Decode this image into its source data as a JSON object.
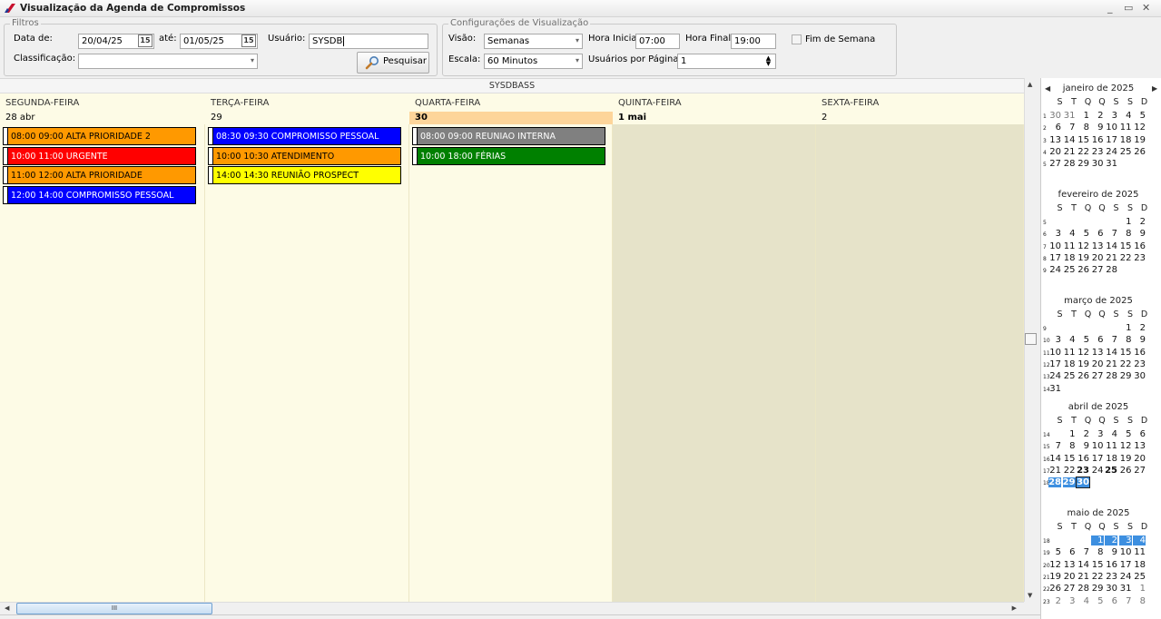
{
  "window": {
    "title": "Visualização da Agenda de Compromissos"
  },
  "filters": {
    "legend": "Filtros",
    "date_from_label": "Data de:",
    "date_from": "20/04/25",
    "date_to_label": "até:",
    "date_to": "01/05/25",
    "user_label": "Usuário:",
    "user": "SYSDB",
    "classification_label": "Classificação:",
    "classification": "",
    "search_button": "Pesquisar",
    "cal_icon_text": "15"
  },
  "view_settings": {
    "legend": "Configurações de Visualização",
    "view_label": "Visão:",
    "view": "Semanas",
    "start_hour_label": "Hora Inicial",
    "start_hour": "07:00",
    "end_hour_label": "Hora Final",
    "end_hour": "19:00",
    "weekend_label": "Fim de Semana",
    "scale_label": "Escala:",
    "scale": "60 Minutos",
    "users_per_page_label": "Usuários por Página",
    "users_per_page": "1"
  },
  "agenda": {
    "user_header": "SYSDBASS",
    "days": [
      {
        "name": "SEGUNDA-FEIRA",
        "number": "28 abr"
      },
      {
        "name": "TERÇA-FEIRA",
        "number": "29"
      },
      {
        "name": "QUARTA-FEIRA",
        "number": "30"
      },
      {
        "name": "QUINTA-FEIRA",
        "number": "1 mai"
      },
      {
        "name": "SEXTA-FEIRA",
        "number": "2"
      }
    ],
    "events": [
      {
        "day": 0,
        "row": 0,
        "text": "08:00 09:00 ALTA PRIORIDADE 2",
        "bg": "#ff9900",
        "fg": "#000000"
      },
      {
        "day": 0,
        "row": 1,
        "text": "10:00 11:00 URGENTE",
        "bg": "#ff0000",
        "fg": "#ffffff"
      },
      {
        "day": 0,
        "row": 2,
        "text": "11:00 12:00 ALTA PRIORIDADE",
        "bg": "#ff9900",
        "fg": "#000000"
      },
      {
        "day": 0,
        "row": 3,
        "text": "12:00 14:00 COMPROMISSO PESSOAL",
        "bg": "#0000ff",
        "fg": "#ffffff"
      },
      {
        "day": 1,
        "row": 0,
        "text": "08:30 09:30 COMPROMISSO PESSOAL",
        "bg": "#0000ff",
        "fg": "#ffffff"
      },
      {
        "day": 1,
        "row": 1,
        "text": "10:00 10:30 ATENDIMENTO",
        "bg": "#ff9900",
        "fg": "#000000"
      },
      {
        "day": 1,
        "row": 2,
        "text": "14:00 14:30 REUNIÃO PROSPECT",
        "bg": "#ffff00",
        "fg": "#000000"
      },
      {
        "day": 2,
        "row": 0,
        "text": "08:00 09:00 REUNIAO INTERNA",
        "bg": "#808080",
        "fg": "#ffffff"
      },
      {
        "day": 2,
        "row": 1,
        "text": "10:00 18:00 FÉRIAS",
        "bg": "#008000",
        "fg": "#ffffff"
      }
    ]
  },
  "scroll": {
    "grip": "III"
  },
  "minicalendar": {
    "weekday_headers": [
      "S",
      "T",
      "Q",
      "Q",
      "S",
      "S",
      "D"
    ],
    "months": [
      {
        "name": "janeiro de 2025",
        "weeks": [
          {
            "wk": "1",
            "days": [
              [
                "30",
                "o"
              ],
              [
                "31",
                "o"
              ],
              [
                "1",
                ""
              ],
              [
                "2",
                ""
              ],
              [
                "3",
                ""
              ],
              [
                "4",
                ""
              ],
              [
                "5",
                ""
              ]
            ]
          },
          {
            "wk": "2",
            "days": [
              [
                "6",
                ""
              ],
              [
                "7",
                ""
              ],
              [
                "8",
                ""
              ],
              [
                "9",
                ""
              ],
              [
                "10",
                ""
              ],
              [
                "11",
                ""
              ],
              [
                "12",
                ""
              ]
            ]
          },
          {
            "wk": "3",
            "days": [
              [
                "13",
                ""
              ],
              [
                "14",
                ""
              ],
              [
                "15",
                ""
              ],
              [
                "16",
                ""
              ],
              [
                "17",
                ""
              ],
              [
                "18",
                ""
              ],
              [
                "19",
                ""
              ]
            ]
          },
          {
            "wk": "4",
            "days": [
              [
                "20",
                ""
              ],
              [
                "21",
                ""
              ],
              [
                "22",
                ""
              ],
              [
                "23",
                ""
              ],
              [
                "24",
                ""
              ],
              [
                "25",
                ""
              ],
              [
                "26",
                ""
              ]
            ]
          },
          {
            "wk": "5",
            "days": [
              [
                "27",
                ""
              ],
              [
                "28",
                ""
              ],
              [
                "29",
                ""
              ],
              [
                "30",
                ""
              ],
              [
                "31",
                ""
              ],
              [
                "",
                ""
              ],
              [
                "",
                ""
              ]
            ]
          }
        ]
      },
      {
        "name": "fevereiro de 2025",
        "weeks": [
          {
            "wk": "5",
            "days": [
              [
                "",
                ""
              ],
              [
                "",
                ""
              ],
              [
                "",
                ""
              ],
              [
                "",
                ""
              ],
              [
                "",
                ""
              ],
              [
                "1",
                ""
              ],
              [
                "2",
                ""
              ]
            ]
          },
          {
            "wk": "6",
            "days": [
              [
                "3",
                ""
              ],
              [
                "4",
                ""
              ],
              [
                "5",
                ""
              ],
              [
                "6",
                ""
              ],
              [
                "7",
                ""
              ],
              [
                "8",
                ""
              ],
              [
                "9",
                ""
              ]
            ]
          },
          {
            "wk": "7",
            "days": [
              [
                "10",
                ""
              ],
              [
                "11",
                ""
              ],
              [
                "12",
                ""
              ],
              [
                "13",
                ""
              ],
              [
                "14",
                ""
              ],
              [
                "15",
                ""
              ],
              [
                "16",
                ""
              ]
            ]
          },
          {
            "wk": "8",
            "days": [
              [
                "17",
                ""
              ],
              [
                "18",
                ""
              ],
              [
                "19",
                ""
              ],
              [
                "20",
                ""
              ],
              [
                "21",
                ""
              ],
              [
                "22",
                ""
              ],
              [
                "23",
                ""
              ]
            ]
          },
          {
            "wk": "9",
            "days": [
              [
                "24",
                ""
              ],
              [
                "25",
                ""
              ],
              [
                "26",
                ""
              ],
              [
                "27",
                ""
              ],
              [
                "28",
                ""
              ],
              [
                "",
                ""
              ],
              [
                "",
                ""
              ]
            ]
          }
        ]
      },
      {
        "name": "março de 2025",
        "weeks": [
          {
            "wk": "9",
            "days": [
              [
                "",
                ""
              ],
              [
                "",
                ""
              ],
              [
                "",
                ""
              ],
              [
                "",
                ""
              ],
              [
                "",
                ""
              ],
              [
                "1",
                ""
              ],
              [
                "2",
                ""
              ]
            ]
          },
          {
            "wk": "10",
            "days": [
              [
                "3",
                ""
              ],
              [
                "4",
                ""
              ],
              [
                "5",
                ""
              ],
              [
                "6",
                ""
              ],
              [
                "7",
                ""
              ],
              [
                "8",
                ""
              ],
              [
                "9",
                ""
              ]
            ]
          },
          {
            "wk": "11",
            "days": [
              [
                "10",
                ""
              ],
              [
                "11",
                ""
              ],
              [
                "12",
                ""
              ],
              [
                "13",
                ""
              ],
              [
                "14",
                ""
              ],
              [
                "15",
                ""
              ],
              [
                "16",
                ""
              ]
            ]
          },
          {
            "wk": "12",
            "days": [
              [
                "17",
                ""
              ],
              [
                "18",
                ""
              ],
              [
                "19",
                ""
              ],
              [
                "20",
                ""
              ],
              [
                "21",
                ""
              ],
              [
                "22",
                ""
              ],
              [
                "23",
                ""
              ]
            ]
          },
          {
            "wk": "13",
            "days": [
              [
                "24",
                ""
              ],
              [
                "25",
                ""
              ],
              [
                "26",
                ""
              ],
              [
                "27",
                ""
              ],
              [
                "28",
                ""
              ],
              [
                "29",
                ""
              ],
              [
                "30",
                ""
              ]
            ]
          },
          {
            "wk": "14",
            "days": [
              [
                "31",
                ""
              ],
              [
                "",
                ""
              ],
              [
                "",
                ""
              ],
              [
                "",
                ""
              ],
              [
                "",
                ""
              ],
              [
                "",
                ""
              ],
              [
                "",
                ""
              ]
            ]
          }
        ]
      },
      {
        "name": "abril de 2025",
        "weeks": [
          {
            "wk": "14",
            "days": [
              [
                "",
                ""
              ],
              [
                "1",
                ""
              ],
              [
                "2",
                ""
              ],
              [
                "3",
                ""
              ],
              [
                "4",
                ""
              ],
              [
                "5",
                ""
              ],
              [
                "6",
                ""
              ]
            ]
          },
          {
            "wk": "15",
            "days": [
              [
                "7",
                ""
              ],
              [
                "8",
                ""
              ],
              [
                "9",
                ""
              ],
              [
                "10",
                ""
              ],
              [
                "11",
                ""
              ],
              [
                "12",
                ""
              ],
              [
                "13",
                ""
              ]
            ]
          },
          {
            "wk": "16",
            "days": [
              [
                "14",
                ""
              ],
              [
                "15",
                ""
              ],
              [
                "16",
                ""
              ],
              [
                "17",
                ""
              ],
              [
                "18",
                ""
              ],
              [
                "19",
                ""
              ],
              [
                "20",
                ""
              ]
            ]
          },
          {
            "wk": "17",
            "days": [
              [
                "21",
                ""
              ],
              [
                "22",
                ""
              ],
              [
                "23",
                "b"
              ],
              [
                "24",
                ""
              ],
              [
                "25",
                "b"
              ],
              [
                "26",
                ""
              ],
              [
                "27",
                ""
              ]
            ]
          },
          {
            "wk": "18",
            "days": [
              [
                "28",
                "s"
              ],
              [
                "29",
                "s"
              ],
              [
                "30",
                "t"
              ],
              [
                "",
                ""
              ],
              [
                "",
                ""
              ],
              [
                "",
                ""
              ],
              [
                "",
                ""
              ]
            ]
          }
        ]
      },
      {
        "name": "maio de 2025",
        "weeks": [
          {
            "wk": "18",
            "days": [
              [
                "",
                ""
              ],
              [
                "",
                ""
              ],
              [
                "",
                ""
              ],
              [
                "1",
                "r"
              ],
              [
                "2",
                "r"
              ],
              [
                "3",
                "r"
              ],
              [
                "4",
                "r"
              ]
            ]
          },
          {
            "wk": "19",
            "days": [
              [
                "5",
                ""
              ],
              [
                "6",
                ""
              ],
              [
                "7",
                ""
              ],
              [
                "8",
                ""
              ],
              [
                "9",
                ""
              ],
              [
                "10",
                ""
              ],
              [
                "11",
                ""
              ]
            ]
          },
          {
            "wk": "20",
            "days": [
              [
                "12",
                ""
              ],
              [
                "13",
                ""
              ],
              [
                "14",
                ""
              ],
              [
                "15",
                ""
              ],
              [
                "16",
                ""
              ],
              [
                "17",
                ""
              ],
              [
                "18",
                ""
              ]
            ]
          },
          {
            "wk": "21",
            "days": [
              [
                "19",
                ""
              ],
              [
                "20",
                ""
              ],
              [
                "21",
                ""
              ],
              [
                "22",
                ""
              ],
              [
                "23",
                ""
              ],
              [
                "24",
                ""
              ],
              [
                "25",
                ""
              ]
            ]
          },
          {
            "wk": "22",
            "days": [
              [
                "26",
                ""
              ],
              [
                "27",
                ""
              ],
              [
                "28",
                ""
              ],
              [
                "29",
                ""
              ],
              [
                "30",
                ""
              ],
              [
                "31",
                ""
              ],
              [
                "1",
                "o"
              ]
            ]
          },
          {
            "wk": "23",
            "days": [
              [
                "2",
                "o"
              ],
              [
                "3",
                "o"
              ],
              [
                "4",
                "o"
              ],
              [
                "5",
                "o"
              ],
              [
                "6",
                "o"
              ],
              [
                "7",
                "o"
              ],
              [
                "8",
                "o"
              ]
            ]
          }
        ]
      }
    ]
  }
}
